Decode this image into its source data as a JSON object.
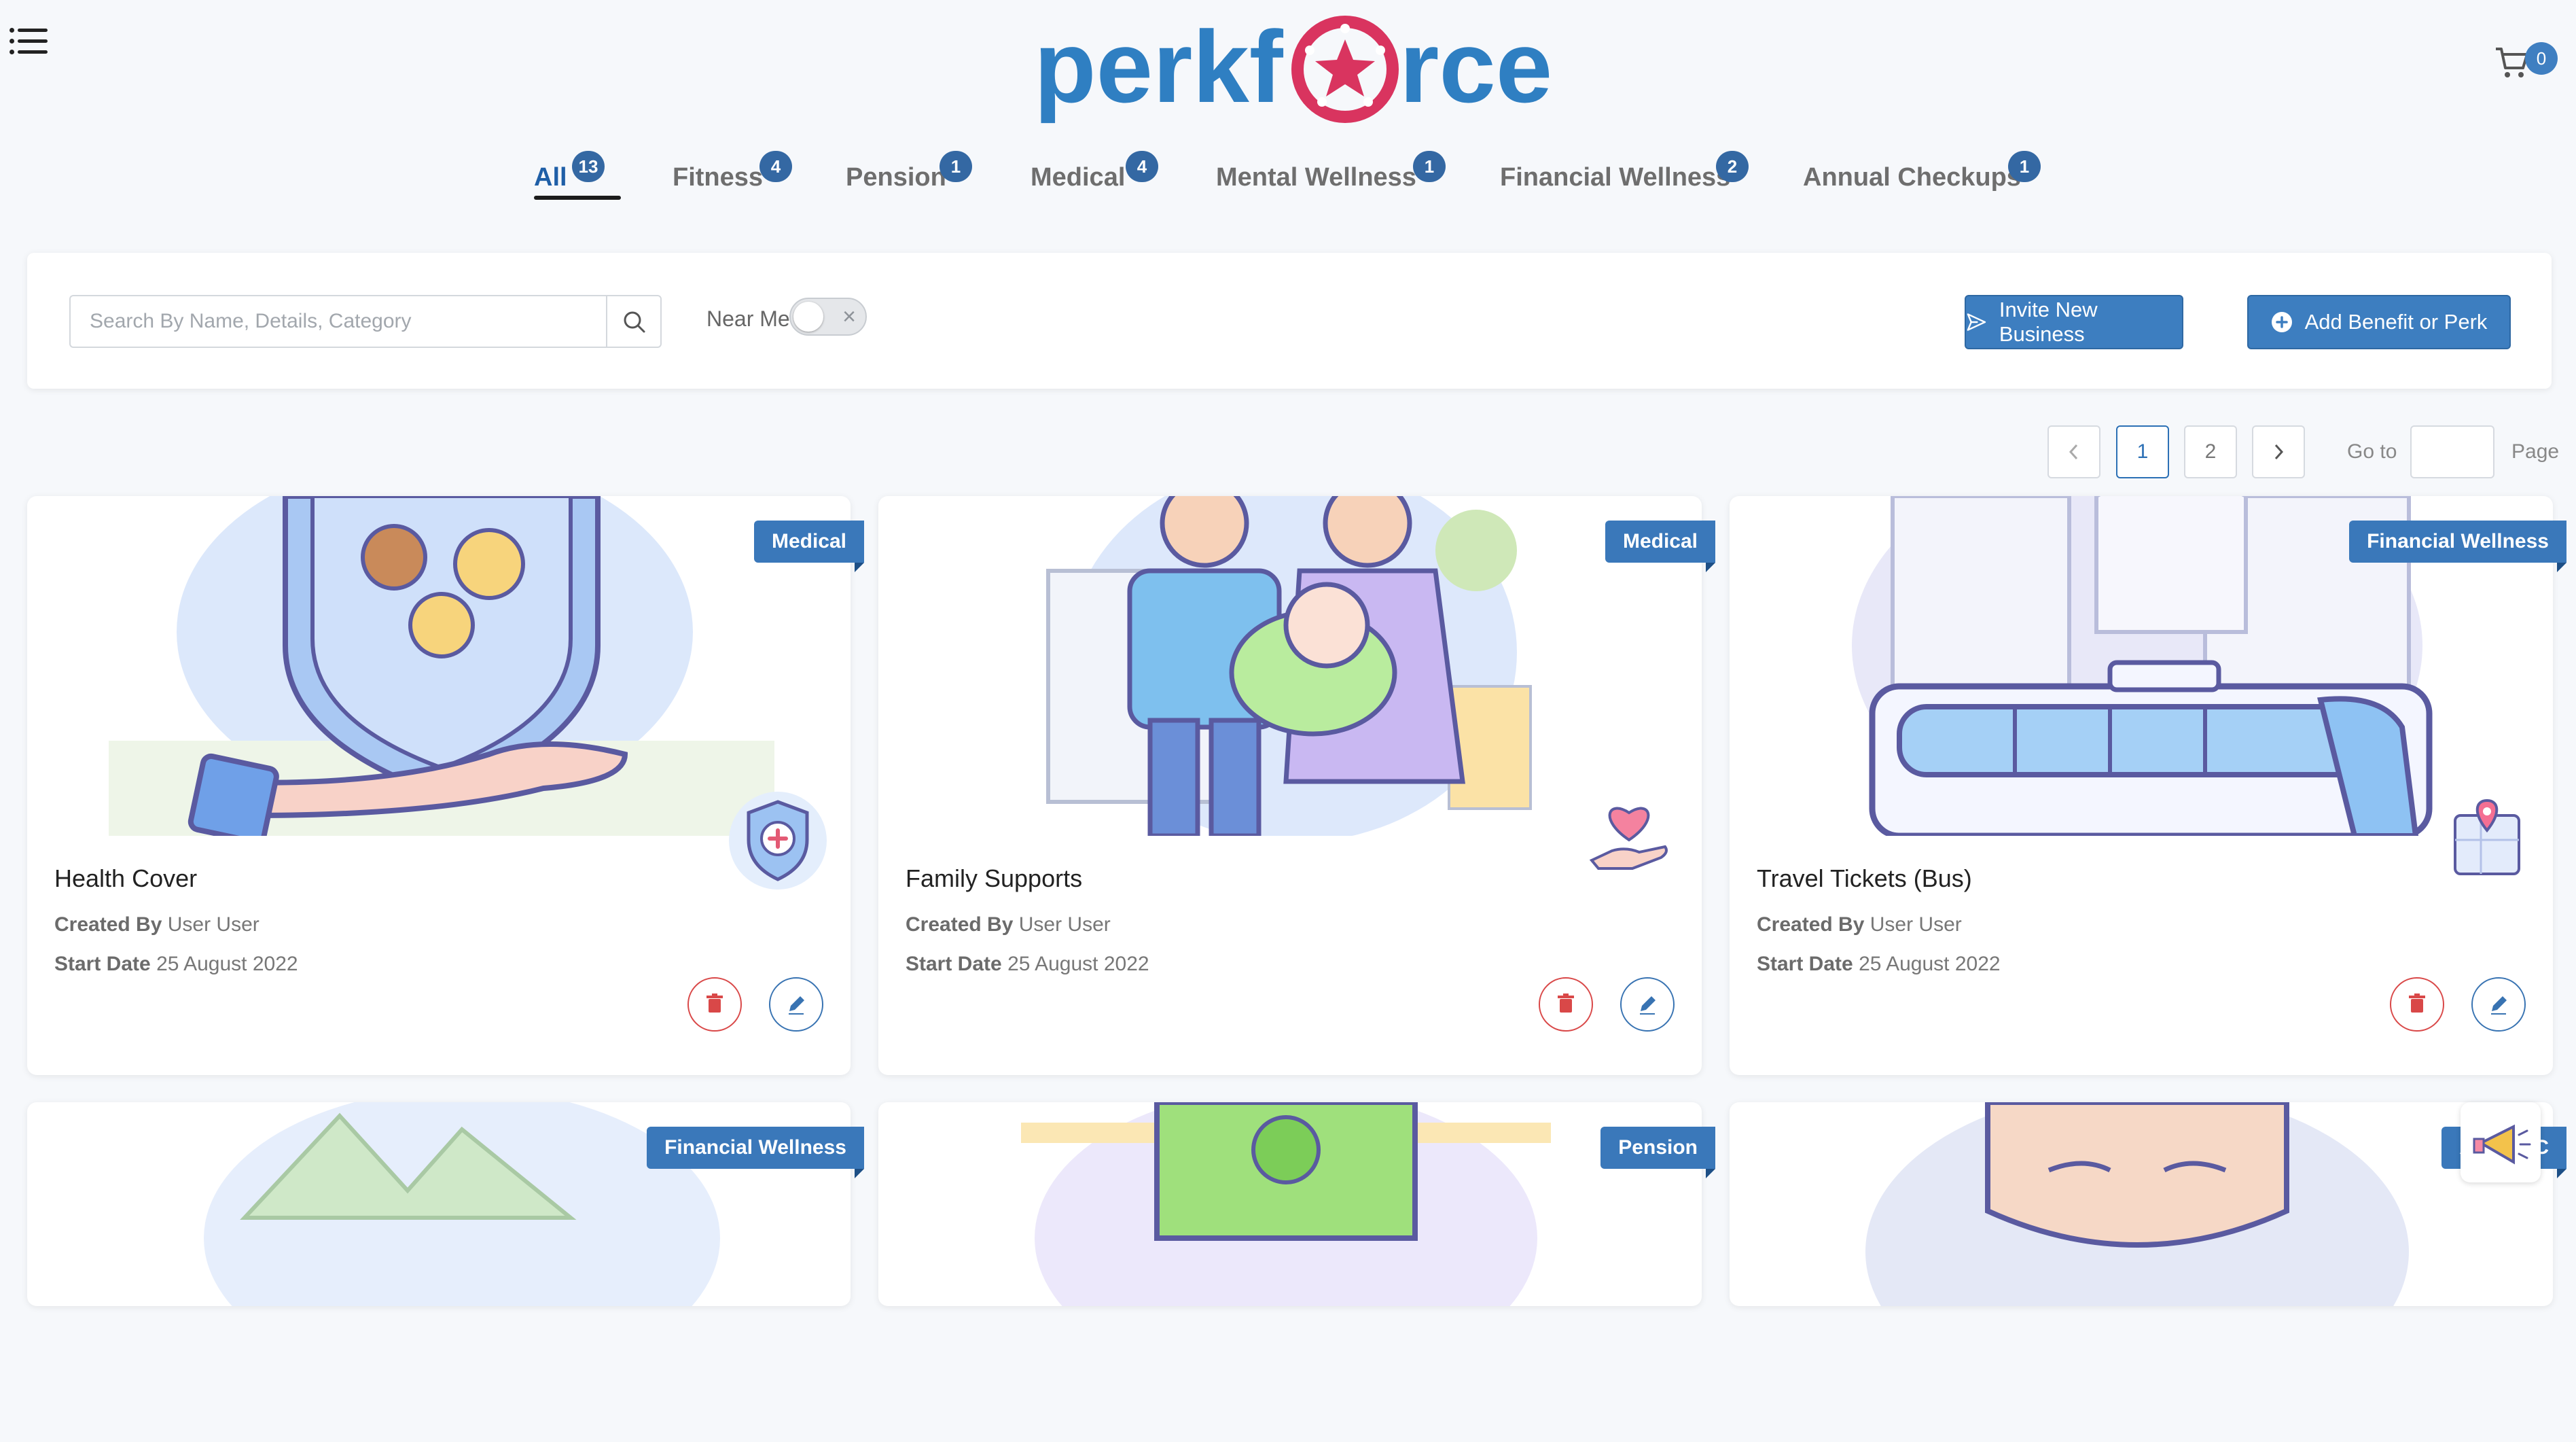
{
  "brand": {
    "logo_text_left": "perkf",
    "logo_text_right": "rce"
  },
  "cart": {
    "count": "0",
    "icon": "cart-icon"
  },
  "tabs": [
    {
      "label": "All",
      "count": "13",
      "active": true
    },
    {
      "label": "Fitness",
      "count": "4"
    },
    {
      "label": "Pension",
      "count": "1"
    },
    {
      "label": "Medical",
      "count": "4"
    },
    {
      "label": "Mental Wellness",
      "count": "1"
    },
    {
      "label": "Financial Wellness",
      "count": "2"
    },
    {
      "label": "Annual Checkups",
      "count": "1"
    }
  ],
  "toolbar": {
    "search_placeholder": "Search By Name, Details, Category",
    "search_value": "",
    "near_me_label": "Near Me",
    "near_me_on": false,
    "invite_label": "Invite New Business",
    "add_label": "Add Benefit or Perk"
  },
  "pagination": {
    "pages": [
      "1",
      "2"
    ],
    "current": "1",
    "goto_label": "Go to",
    "page_label": "Page",
    "goto_value": ""
  },
  "cards": [
    {
      "title": "Health Cover",
      "category": "Medical",
      "created_by_label": "Created By",
      "created_by": "User User",
      "start_label": "Start Date",
      "start_date": "25 August 2022",
      "icon": "medical-shield-icon"
    },
    {
      "title": "Family Supports",
      "category": "Medical",
      "created_by_label": "Created By",
      "created_by": "User User",
      "start_label": "Start Date",
      "start_date": "25 August 2022",
      "icon": "heart-hand-icon"
    },
    {
      "title": "Travel Tickets (Bus)",
      "category": "Financial Wellness",
      "created_by_label": "Created By",
      "created_by": "User User",
      "start_label": "Start Date",
      "start_date": "25 August 2022",
      "icon": "map-pin-icon"
    },
    {
      "title": "",
      "category": "Financial Wellness"
    },
    {
      "title": "",
      "category": "Pension"
    },
    {
      "title": "",
      "category": "Annual Checkups",
      "category_visible": "Annual C"
    }
  ],
  "colors": {
    "accent": "#3d7ec0",
    "badge": "#3468a3",
    "delete": "#d94848",
    "brand_pink": "#d9345f",
    "brand_blue": "#2f7fc2"
  }
}
